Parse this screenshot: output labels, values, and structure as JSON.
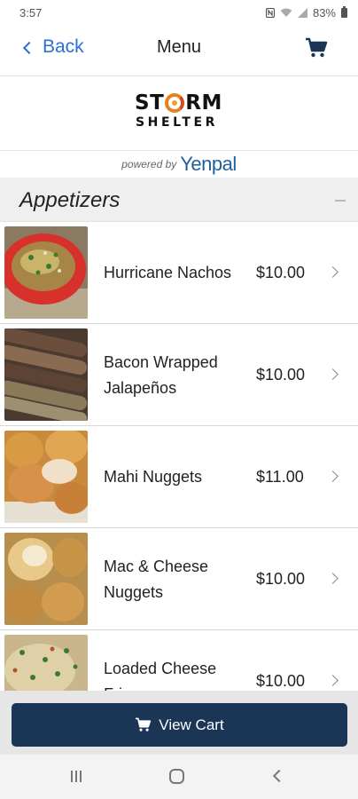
{
  "status_bar": {
    "time": "3:57",
    "battery": "83%"
  },
  "nav": {
    "back_label": "Back",
    "title": "Menu",
    "icons": {
      "back": "chevron-left-icon",
      "cart": "cart-icon"
    }
  },
  "brand": {
    "name_line1_a": "ST",
    "name_line1_b": "RM",
    "name_line2": "SHELTER",
    "powered_by": "powered by",
    "platform": "Yenpal"
  },
  "section": {
    "title": "Appetizers"
  },
  "menu_items": [
    {
      "name": "Hurricane Nachos",
      "price": "$10.00"
    },
    {
      "name": "Bacon Wrapped Jalapeños",
      "price": "$10.00"
    },
    {
      "name": "Mahi Nuggets",
      "price": "$11.00"
    },
    {
      "name": "Mac & Cheese Nuggets",
      "price": "$10.00"
    },
    {
      "name": "Loaded Cheese Fries",
      "price": "$10.00"
    }
  ],
  "cart_bar": {
    "button_label": "View Cart"
  },
  "colors": {
    "accent": "#2c6fd6",
    "primary_button": "#1b3557",
    "section_bg": "#efefef"
  }
}
